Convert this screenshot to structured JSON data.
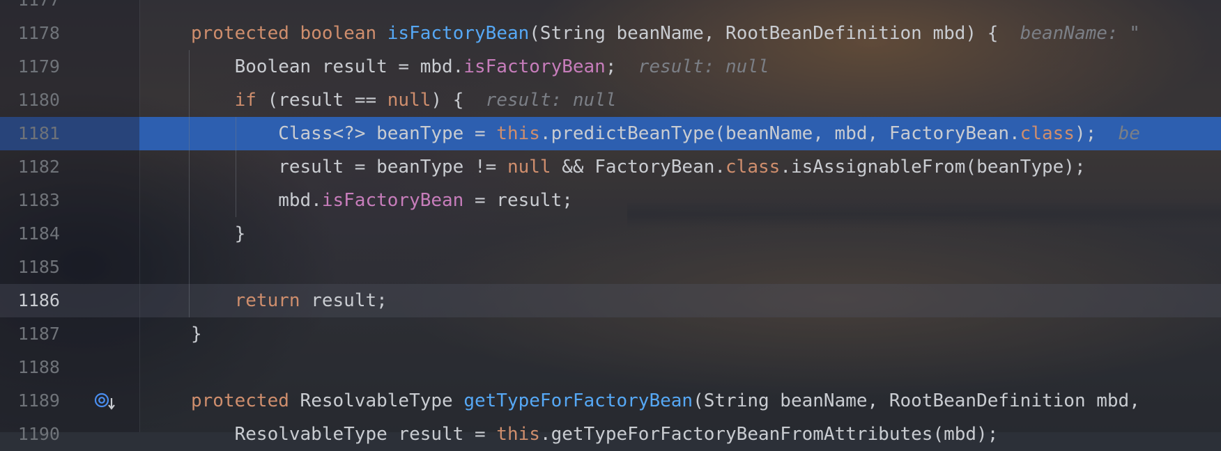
{
  "editor": {
    "lines": [
      {
        "num": "1177",
        "segments": []
      },
      {
        "num": "1178",
        "segments": [
          {
            "t": "protected",
            "c": "kw"
          },
          {
            "t": " ",
            "c": "txt"
          },
          {
            "t": "boolean",
            "c": "kw"
          },
          {
            "t": " ",
            "c": "txt"
          },
          {
            "t": "isFactoryBean",
            "c": "fn"
          },
          {
            "t": "(String beanName, RootBeanDefinition mbd) {",
            "c": "txt"
          },
          {
            "t": "  beanName: \"",
            "c": "hint"
          }
        ]
      },
      {
        "num": "1179",
        "segments": [
          {
            "t": "    Boolean result = mbd.",
            "c": "txt"
          },
          {
            "t": "isFactoryBean",
            "c": "fld"
          },
          {
            "t": ";",
            "c": "txt"
          },
          {
            "t": "  result: null",
            "c": "hint"
          }
        ]
      },
      {
        "num": "1180",
        "segments": [
          {
            "t": "    ",
            "c": "txt"
          },
          {
            "t": "if",
            "c": "kw"
          },
          {
            "t": " (result == ",
            "c": "txt"
          },
          {
            "t": "null",
            "c": "kw"
          },
          {
            "t": ") {",
            "c": "txt"
          },
          {
            "t": "  result: null",
            "c": "hint"
          }
        ]
      },
      {
        "num": "1181",
        "segments": [
          {
            "t": "        Class<?> beanType = ",
            "c": "txt"
          },
          {
            "t": "this",
            "c": "kw"
          },
          {
            "t": ".predictBeanType(beanName, mbd, FactoryBean.",
            "c": "txt"
          },
          {
            "t": "class",
            "c": "kw"
          },
          {
            "t": ");",
            "c": "txt"
          },
          {
            "t": "  be",
            "c": "hint"
          }
        ]
      },
      {
        "num": "1182",
        "segments": [
          {
            "t": "        result = beanType != ",
            "c": "txt"
          },
          {
            "t": "null",
            "c": "kw"
          },
          {
            "t": " && FactoryBean.",
            "c": "txt"
          },
          {
            "t": "class",
            "c": "kw"
          },
          {
            "t": ".isAssignableFrom(beanType);",
            "c": "txt"
          }
        ]
      },
      {
        "num": "1183",
        "segments": [
          {
            "t": "        mbd.",
            "c": "txt"
          },
          {
            "t": "isFactoryBean",
            "c": "fld"
          },
          {
            "t": " = result;",
            "c": "txt"
          }
        ]
      },
      {
        "num": "1184",
        "segments": [
          {
            "t": "    }",
            "c": "txt"
          }
        ]
      },
      {
        "num": "1185",
        "segments": []
      },
      {
        "num": "1186",
        "segments": [
          {
            "t": "    ",
            "c": "txt"
          },
          {
            "t": "return",
            "c": "kw"
          },
          {
            "t": " result;",
            "c": "txt"
          }
        ]
      },
      {
        "num": "1187",
        "segments": [
          {
            "t": "}",
            "c": "txt"
          }
        ]
      },
      {
        "num": "1188",
        "segments": []
      },
      {
        "num": "1189",
        "segments": [
          {
            "t": "protected",
            "c": "kw"
          },
          {
            "t": " ResolvableType ",
            "c": "txt"
          },
          {
            "t": "getTypeForFactoryBean",
            "c": "fn"
          },
          {
            "t": "(String beanName, RootBeanDefinition mbd,",
            "c": "txt"
          }
        ]
      },
      {
        "num": "1190",
        "segments": [
          {
            "t": "    ResolvableType result = ",
            "c": "txt"
          },
          {
            "t": "this",
            "c": "kw"
          },
          {
            "t": ".getTypeForFactoryBeanFromAttributes(mbd);",
            "c": "txt"
          }
        ]
      }
    ],
    "execution_line": "1181",
    "caret_line": "1186",
    "gutter_icon": "implements-method-icon"
  },
  "colors": {
    "keyword": "#cf8e6d",
    "method_declaration": "#56a8f5",
    "field": "#c77dbb",
    "plain": "#c9ccd1",
    "inline_hint": "#7b7f86",
    "execution_highlight": "#2d5fb0"
  }
}
